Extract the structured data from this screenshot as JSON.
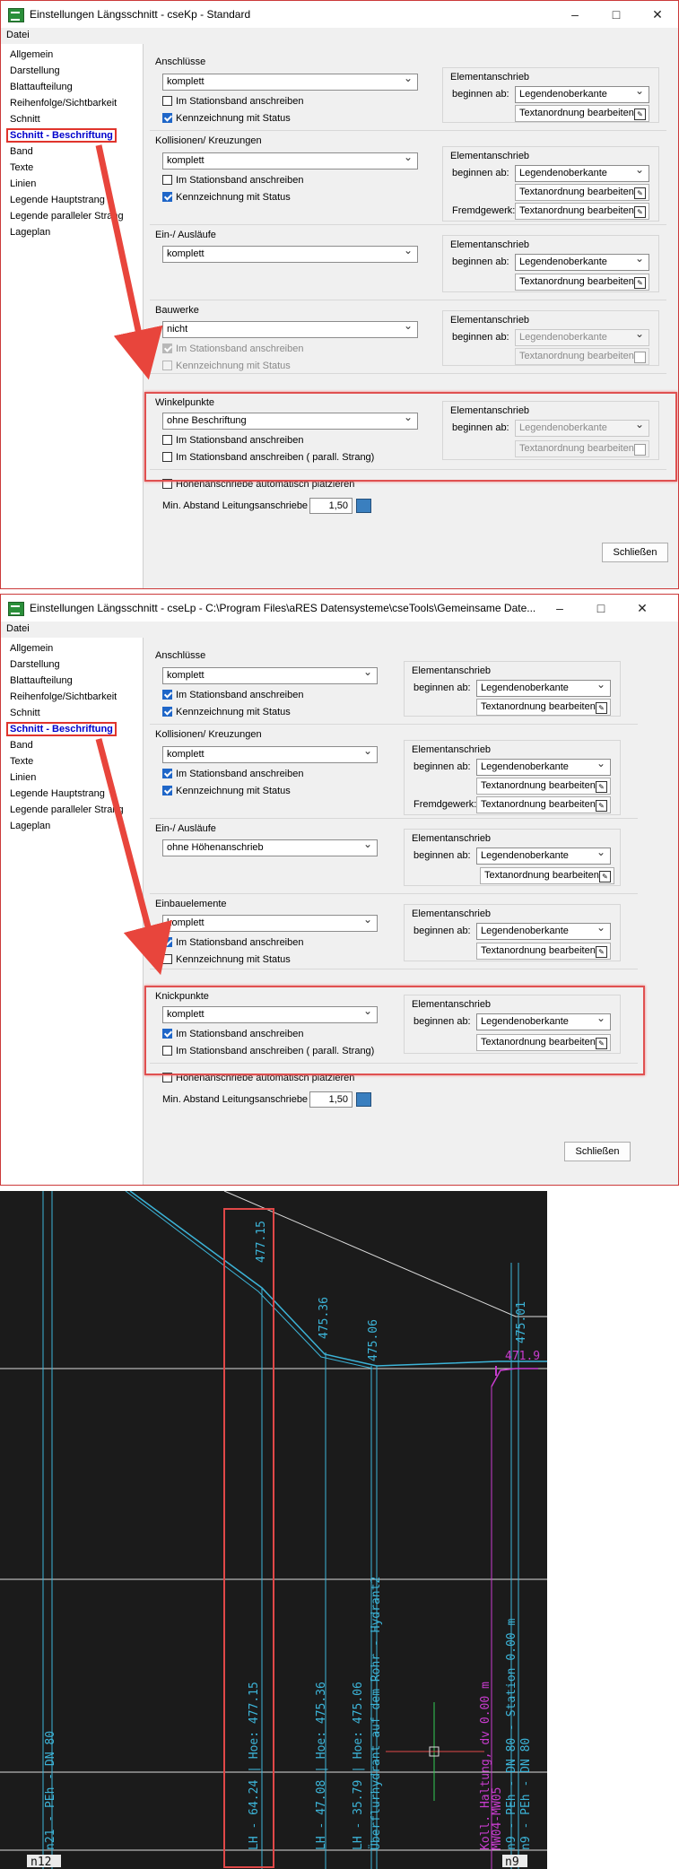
{
  "window1": {
    "title": "Einstellungen Längsschnitt - cseKp - Standard",
    "menu": "Datei",
    "nav": [
      "Allgemein",
      "Darstellung",
      "Blattaufteilung",
      "Reihenfolge/Sichtbarkeit",
      "Schnitt",
      "Schnitt - Beschriftung",
      "Band",
      "Texte",
      "Linien",
      "Legende Hauptstrang",
      "Legende paralleler Strang",
      "Lageplan"
    ],
    "sections": {
      "anschluesse": {
        "title": "Anschlüsse",
        "combo": "komplett",
        "cb1": "Im Stationsband anschreiben",
        "cb2": "Kennzeichnung mit Status"
      },
      "kollisionen": {
        "title": "Kollisionen/ Kreuzungen",
        "combo": "komplett",
        "cb1": "Im Stationsband anschreiben",
        "cb2": "Kennzeichnung mit Status"
      },
      "einauslaeufe": {
        "title": "Ein-/ Ausläufe",
        "combo": "komplett"
      },
      "bauwerke": {
        "title": "Bauwerke",
        "combo": "nicht",
        "cb1": "Im Stationsband anschreiben",
        "cb2": "Kennzeichnung mit Status"
      },
      "winkelpunkte": {
        "title": "Winkelpunkte",
        "combo": "ohne Beschriftung",
        "cb1": "Im Stationsband anschreiben",
        "cb2": "Im Stationsband anschreiben ( parall. Strang)"
      }
    },
    "group": {
      "title": "Elementanschrieb",
      "beginnen": "beginnen ab:",
      "value": "Legendenoberkante",
      "textbtn": "Textanordnung bearbeiten",
      "fremd": "Fremdgewerk:"
    },
    "hoehen": "Höhenanschriebe automatisch platzieren",
    "min_abstand_label": "Min. Abstand Leitungsanschriebe",
    "min_abstand_value": "1,50",
    "close": "Schließen"
  },
  "window2": {
    "title": "Einstellungen Längsschnitt - cseLp - C:\\Program Files\\aRES Datensysteme\\cseTools\\Gemeinsame Date...",
    "menu": "Datei",
    "nav": [
      "Allgemein",
      "Darstellung",
      "Blattaufteilung",
      "Reihenfolge/Sichtbarkeit",
      "Schnitt",
      "Schnitt - Beschriftung",
      "Band",
      "Texte",
      "Linien",
      "Legende Hauptstrang",
      "Legende paralleler Strang",
      "Lageplan"
    ],
    "sections": {
      "anschluesse": {
        "title": "Anschlüsse",
        "combo": "komplett",
        "cb1": "Im Stationsband anschreiben",
        "cb2": "Kennzeichnung mit Status"
      },
      "kollisionen": {
        "title": "Kollisionen/ Kreuzungen",
        "combo": "komplett",
        "cb1": "Im Stationsband anschreiben",
        "cb2": "Kennzeichnung mit Status"
      },
      "einauslaeufe": {
        "title": "Ein-/ Ausläufe",
        "combo": "ohne Höhenanschrieb"
      },
      "einbauelemente": {
        "title": "Einbauelemente",
        "combo": "komplett",
        "cb1": "Im Stationsband anschreiben",
        "cb2": "Kennzeichnung mit Status"
      },
      "knickpunkte": {
        "title": "Knickpunkte",
        "combo": "komplett",
        "cb1": "Im Stationsband anschreiben",
        "cb2": "Im Stationsband anschreiben ( parall. Strang)"
      }
    },
    "group": {
      "title": "Elementanschrieb",
      "beginnen": "beginnen ab:",
      "value": "Legendenoberkante",
      "textbtn": "Textanordnung bearbeiten",
      "fremd": "Fremdgewerk:"
    },
    "hoehen": "Höhenanschriebe automatisch platzieren",
    "min_abstand_label": "Min. Abstand Leitungsanschriebe",
    "min_abstand_value": "1,50",
    "close": "Schließen"
  },
  "cad": {
    "labels": {
      "top_477": "477.15",
      "top_47536": "475.36",
      "top_47506": "475.06",
      "top_47501": "475.01",
      "top_4719": "471.9",
      "v_n21": "n21 - PEh - DN 80",
      "v_lh1": "LH - 64.24 | Hoe: 477.15",
      "v_lh2": "LH - 47.08 | Hoe: 475.36",
      "v_lh3": "LH - 35.79 | Hoe: 475.06",
      "v_ueber": "Überflurhydrant auf dem Rohr - Hydrant2",
      "v_koll": "Koll. Haltung, dv 0.00 m",
      "v_mw": "MW04-MW05",
      "v_n9a": "n9 - PEh - DN 80 - Station 0.00 m",
      "v_n9b": "n9 - PEh - DN 80",
      "n12": "n12",
      "n9": "n9"
    },
    "colors": {
      "bg": "#1b1b1b",
      "cyan": "#3cb4d8",
      "magenta": "#c83ccf",
      "white": "#dcdcdc",
      "green": "#33cc55",
      "red": "#e04848"
    }
  }
}
